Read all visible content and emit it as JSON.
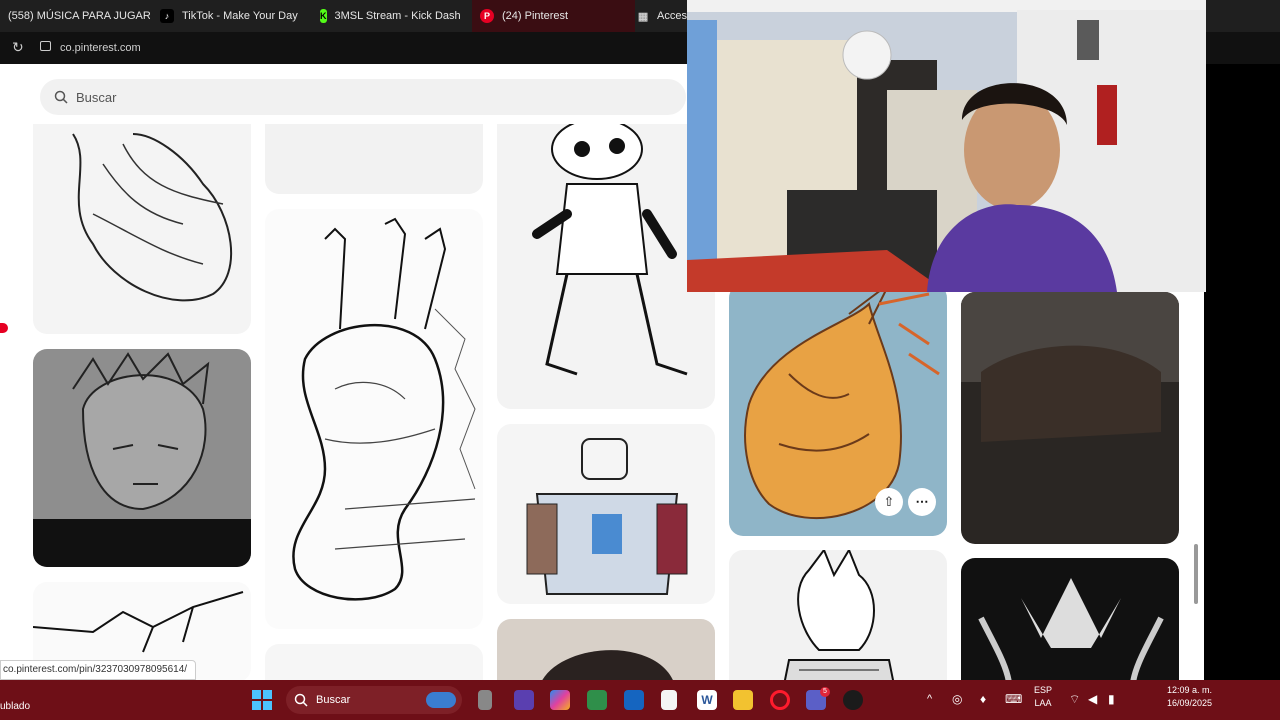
{
  "browser": {
    "tabs": [
      {
        "label": "(558) MÚSICA PARA JUGAR",
        "icon": "youtube-icon",
        "color": "#ff0000"
      },
      {
        "label": "TikTok - Make Your Day",
        "icon": "tiktok-icon",
        "color": "#000000"
      },
      {
        "label": "3MSL Stream - Kick Dash",
        "icon": "kick-icon",
        "color": "#53fc18"
      },
      {
        "label": "(24) Pinterest",
        "icon": "pinterest-icon",
        "color": "#e60023"
      },
      {
        "label": "Acces",
        "icon": "grid-icon",
        "color": "#cccccc"
      }
    ],
    "address": "co.pinterest.com",
    "status_url": "co.pinterest.com/pin/3237030978095614/"
  },
  "search": {
    "placeholder": "Buscar"
  },
  "taskbar": {
    "search_label": "Buscar",
    "lang_1": "ESP",
    "lang_2": "LAA",
    "time": "12:09 a. m.",
    "date": "16/09/2025",
    "left_text": "ublado",
    "badge": "5"
  },
  "colors": {
    "accent": "#e60023",
    "taskbar": "#6e0f17"
  }
}
